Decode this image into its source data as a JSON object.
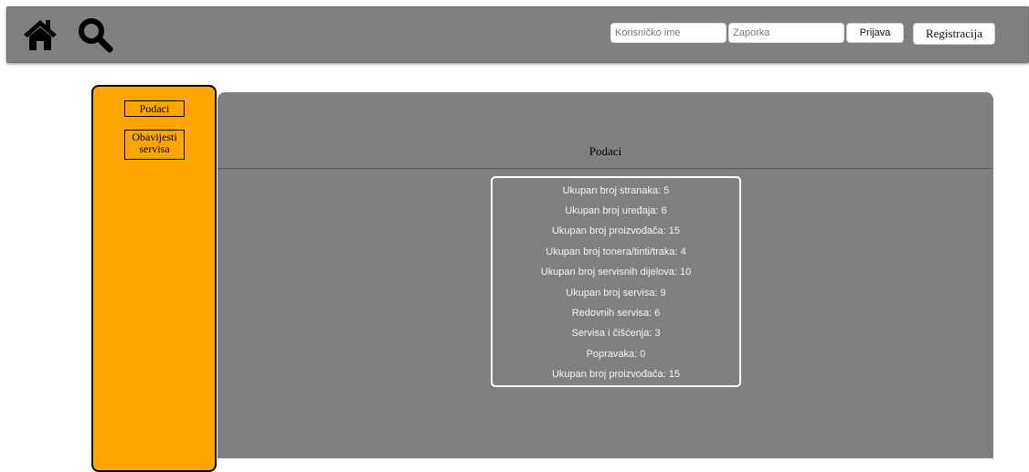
{
  "header": {
    "icons": [
      "home-icon",
      "search-icon"
    ],
    "username_placeholder": "Korisničko ime",
    "password_placeholder": "Zaporka",
    "login_label": "Prijava",
    "register_label": "Registracija"
  },
  "sidebar": {
    "items": [
      {
        "label": "Podaci"
      },
      {
        "label_line1": "Obavijesti",
        "label_line2": "servisa"
      }
    ]
  },
  "main": {
    "title": "Podaci",
    "stats": [
      "Ukupan broj stranaka: 5",
      "Ukupan broj uređaja: 6",
      "Ukupan broj proizvođača: 15",
      "Ukupan broj tonera/tinti/traka: 4",
      "Ukupan broj servisnih dijelova: 10",
      "Ukupan broj servisa: 9",
      "Redovnih servisa: 6",
      "Servisa i čišćenja: 3",
      "Popravaka: 0",
      "Ukupan broj proizvođača: 15"
    ]
  },
  "colors": {
    "header_bg": "#808080",
    "sidebar_bg": "#ffa500",
    "panel_bg": "#808080",
    "stats_text": "#f4f4f4"
  }
}
